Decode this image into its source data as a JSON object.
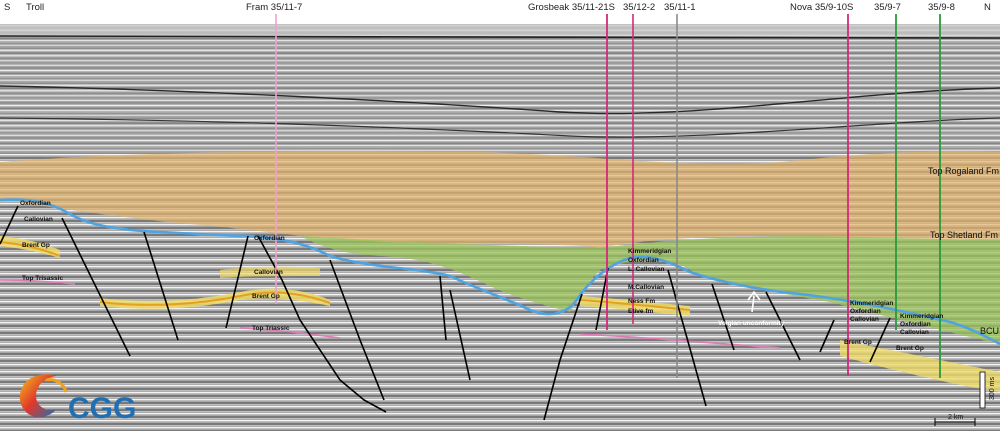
{
  "direction": {
    "left": "S",
    "right": "N"
  },
  "wells": [
    {
      "name": "Troll",
      "color": "#000000"
    },
    {
      "name": "Fram 35/11-7",
      "color": "#f0a0d0"
    },
    {
      "name": "Grosbeak 35/11-21S",
      "color": "#d6287a"
    },
    {
      "name": "35/12-2",
      "color": "#d6287a"
    },
    {
      "name": "35/11-1",
      "color": "#8a8a8a"
    },
    {
      "name": "Nova 35/9-10S",
      "color": "#d6287a"
    },
    {
      "name": "35/9-7",
      "color": "#2a9a3a"
    },
    {
      "name": "35/9-8",
      "color": "#2a9a3a"
    }
  ],
  "horizons": {
    "top_rogaland": "Top Rogaland Fm",
    "top_shetland": "Top Shetland Fm",
    "bcu": "BCU"
  },
  "labels": {
    "oxfordian": "Oxfordian",
    "callovian": "Callovian",
    "brent": "Brent Gp",
    "trias": "Top Trisassic",
    "fram_oxf": "Oxfordian",
    "fram_call": "Callovian",
    "fram_brent": "Brent Gp",
    "fram_trias": "Top Triassic",
    "grb_kimm": "Kimmeridgian",
    "grb_oxf": "Oxfordian",
    "grb_lcall": "L. Callovian",
    "grb_mcall": "M.Callovian",
    "grb_ness": "Ness Fm",
    "grb_etive": "Etive fm",
    "volgian": "Volgian unconformity",
    "nova_kimm": "Kimmeridgian",
    "nova_oxf": "Oxfordian",
    "nova_call": "Callovian",
    "nova_brent": "Brent Gp",
    "n98_kimm": "Kimmeridgian",
    "n98_oxf": "Oxfordian",
    "n98_call": "Callovian",
    "n98_brent": "Brent Gp"
  },
  "scale": {
    "vertical": "300 ms",
    "horizontal": "2 km"
  },
  "logo": {
    "text": "CGG",
    "colors": [
      "#1f6fb2",
      "#f2a11c",
      "#e2372a"
    ]
  },
  "colors": {
    "rogaland_shetland_fill": "#e5b56c",
    "shetland_bcu_fill": "#9bc45a",
    "bcu_line": "#4fa3e0",
    "brent_fill": "#f0dc6a",
    "brent_line": "#e6a020",
    "trias_line": "#e07ab8"
  }
}
